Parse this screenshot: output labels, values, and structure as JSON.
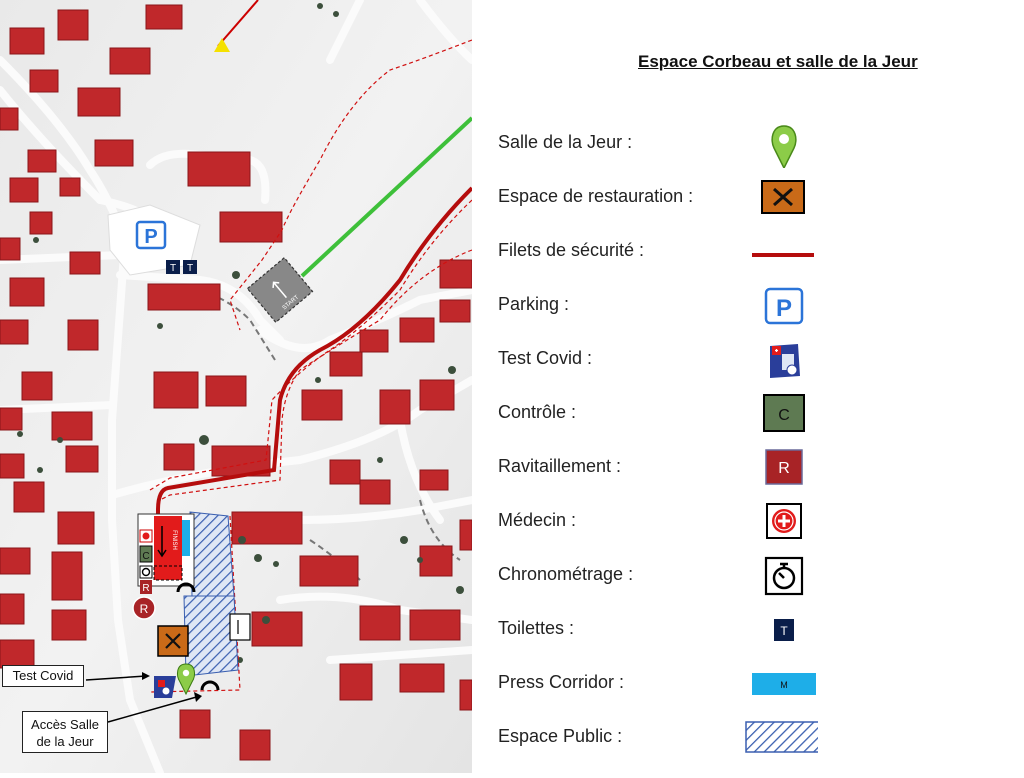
{
  "legend": {
    "title": "Espace Corbeau et salle de la Jeur",
    "items": [
      {
        "label": "Salle de la Jeur :",
        "icon": "map-pin-icon"
      },
      {
        "label": "Espace de restauration :",
        "icon": "fork-knife-icon"
      },
      {
        "label": "Filets de sécurité :",
        "icon": "red-line-icon"
      },
      {
        "label": "Parking :",
        "icon": "parking-icon",
        "symbol_text": "P"
      },
      {
        "label": "Test Covid :",
        "icon": "covid-test-icon"
      },
      {
        "label": "Contrôle :",
        "icon": "control-icon",
        "symbol_text": "C"
      },
      {
        "label": "Ravitaillement :",
        "icon": "refreshment-icon",
        "symbol_text": "R"
      },
      {
        "label": "Médecin :",
        "icon": "medic-icon"
      },
      {
        "label": "Chronométrage :",
        "icon": "stopwatch-icon"
      },
      {
        "label": "Toilettes :",
        "icon": "toilet-icon",
        "symbol_text": "T"
      },
      {
        "label": "Press Corridor :",
        "icon": "press-corridor-icon",
        "symbol_text": "M"
      },
      {
        "label": "Espace Public :",
        "icon": "hatched-area-icon"
      }
    ]
  },
  "map": {
    "callouts": {
      "test_covid": "Test Covid",
      "acces_salle_line1": "Accès Salle",
      "acces_salle_line2": "de la Jeur"
    },
    "start_label": "START",
    "finish_label": "FINISH",
    "parking_label": "P",
    "toilet_label": "T",
    "control_label": "C",
    "refreshment_label": "R"
  },
  "colors": {
    "building": "#c0282b",
    "net_red": "#b50d0d",
    "course_green": "#3ec03a",
    "public_hatch": "#3a5fb0",
    "press_blue": "#1eaee8",
    "control_green": "#5e7a52",
    "toilet_navy": "#0a1e4a"
  }
}
